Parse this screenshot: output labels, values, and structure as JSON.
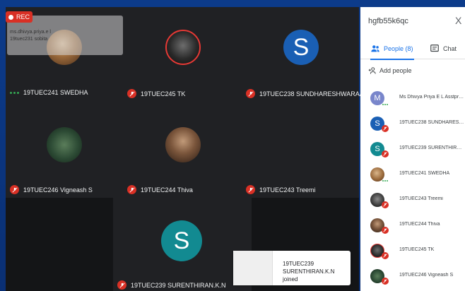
{
  "recording": {
    "label": "REC"
  },
  "overlay": {
    "line1": "ms.dhivya.priya.e l",
    "line2": "19tuec231 sobita"
  },
  "tiles": [
    {
      "name": "19TUEC241 SWEDHA",
      "mic": "speaking"
    },
    {
      "name": "19TUEC245 TK",
      "mic": "muted"
    },
    {
      "name": "19TUEC238 SUNDHARESHWARAA.M",
      "mic": "muted",
      "initial": "S"
    },
    {
      "name": "19TUEC246 Vigneash S",
      "mic": "muted"
    },
    {
      "name": "19TUEC244 Thiva",
      "mic": "muted"
    },
    {
      "name": "19TUEC243 Treemi",
      "mic": "muted"
    },
    {
      "name": "19TUEC239 SURENTHIRAN.K.N",
      "mic": "muted",
      "initial": "S"
    }
  ],
  "toast": {
    "text": "19TUEC239 SURENTHIRAN.K.N joined"
  },
  "panel": {
    "meeting_code": "hgfb55k6qc",
    "close": "X",
    "tabs": [
      {
        "label": "People (8)",
        "icon": "people-icon",
        "active": true
      },
      {
        "label": "Chat",
        "icon": "chat-icon",
        "active": false
      }
    ],
    "add_people": "Add people",
    "people": [
      {
        "name": "Ms Dhivya Priya E L Asstprof E...",
        "initial": "M",
        "status": "speaking"
      },
      {
        "name": "19TUEC238 SUNDHARESHWA...",
        "initial": "S",
        "status": "muted"
      },
      {
        "name": "19TUEC239 SURENTHIRAN.K.N",
        "initial": "S",
        "status": "muted"
      },
      {
        "name": "19TUEC241 SWEDHA",
        "initial": "",
        "status": "speaking"
      },
      {
        "name": "19TUEC243 Treemi",
        "initial": "",
        "status": "muted"
      },
      {
        "name": "19TUEC244 Thiva",
        "initial": "",
        "status": "muted"
      },
      {
        "name": "19TUEC245 TK",
        "initial": "",
        "status": "muted"
      },
      {
        "name": "19TUEC246 Vigneash S",
        "initial": "",
        "status": "muted"
      }
    ]
  },
  "colors": {
    "muted": "#d93025",
    "speaking": "#34a853",
    "accent": "#1a73e8"
  }
}
